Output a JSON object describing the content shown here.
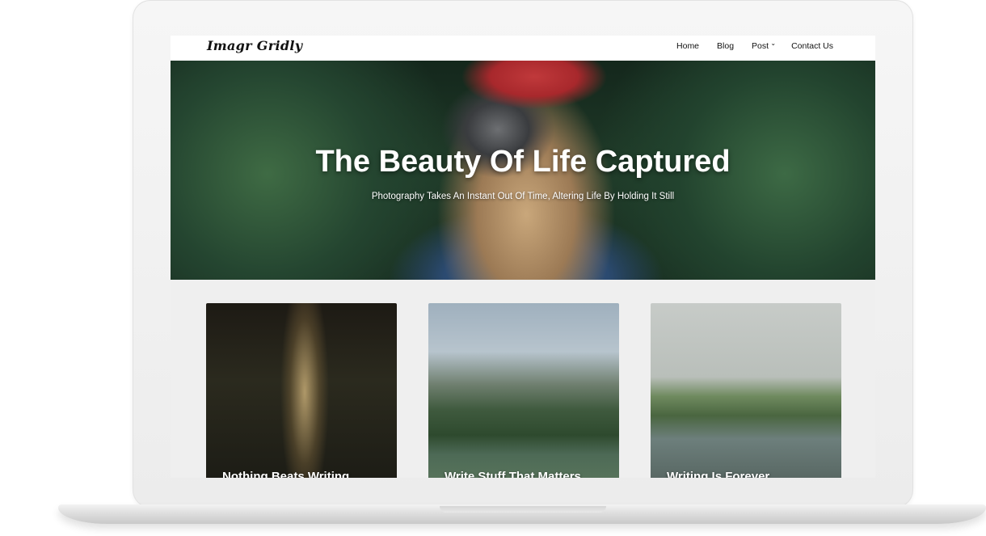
{
  "site": {
    "logo": "Imagr Gridly"
  },
  "nav": {
    "items": [
      {
        "label": "Home"
      },
      {
        "label": "Blog"
      },
      {
        "label": "Post",
        "icon": "chevron-down-icon"
      },
      {
        "label": "Contact Us"
      }
    ]
  },
  "hero": {
    "title": "The Beauty Of Life Captured",
    "subtitle": "Photography Takes An Instant Out Of Time, Altering Life By Holding It Still"
  },
  "cards": [
    {
      "title": "Nothing Beats Writing"
    },
    {
      "title": "Write Stuff That Matters"
    },
    {
      "title": "Writing Is Forever"
    }
  ]
}
